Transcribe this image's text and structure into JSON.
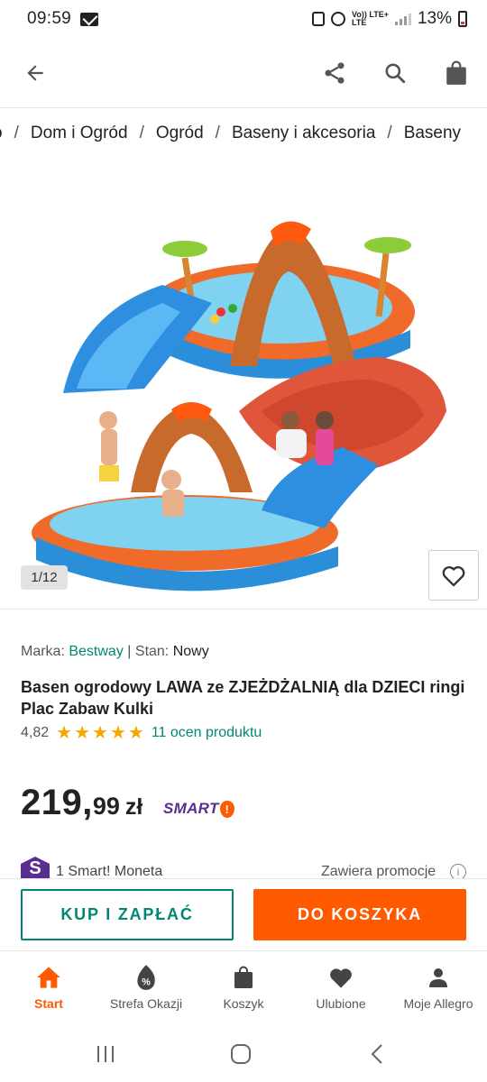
{
  "status_bar": {
    "time": "09:59",
    "network_label_top": "Vo)) LTE+",
    "network_label_bottom": "LTE",
    "battery_percent": "13%"
  },
  "app_bar": {
    "back_icon": "arrow-left-icon",
    "share_icon": "share-icon",
    "search_icon": "search-icon",
    "bag_icon": "shopping-bag-icon"
  },
  "breadcrumb": {
    "items": [
      "o",
      "Dom i Ogród",
      "Ogród",
      "Baseny i akcesoria",
      "Baseny"
    ],
    "separator": "/"
  },
  "gallery": {
    "counter": "1/12",
    "favorite_icon": "heart-icon"
  },
  "product": {
    "brand_label": "Marka:",
    "brand_value": "Bestway",
    "divider": "|",
    "condition_label": "Stan:",
    "condition_value": "Nowy",
    "title": "Basen ogrodowy LAWA ze ZJEŻDŻALNIĄ dla DZIECI ringi Plac Zabaw Kulki",
    "rating_value": "4,82",
    "rating_stars": 5,
    "rating_count_text": "11 ocen produktu",
    "price_main": "219,",
    "price_fraction": "99",
    "price_currency": "zł",
    "smart_label": "SMART",
    "smart_mark": "!",
    "moneta_badge": "S",
    "moneta_text": "1 Smart! Moneta",
    "promo_text": "Zawiera promocje",
    "info_icon": "info-icon"
  },
  "actions": {
    "buy_now": "KUP I ZAPŁAĆ",
    "add_to_cart": "DO KOSZYKA"
  },
  "bottom_nav": [
    {
      "label": "Start",
      "icon": "home-icon",
      "active": true
    },
    {
      "label": "Strefa Okazji",
      "icon": "discount-icon",
      "active": false
    },
    {
      "label": "Koszyk",
      "icon": "bag-icon",
      "active": false
    },
    {
      "label": "Ulubione",
      "icon": "heart-icon",
      "active": false
    },
    {
      "label": "Moje Allegro",
      "icon": "user-icon",
      "active": false
    }
  ],
  "colors": {
    "accent_orange": "#ff5a00",
    "accent_teal": "#008673",
    "smart_purple": "#5a2d91",
    "star_yellow": "#f5a700"
  }
}
